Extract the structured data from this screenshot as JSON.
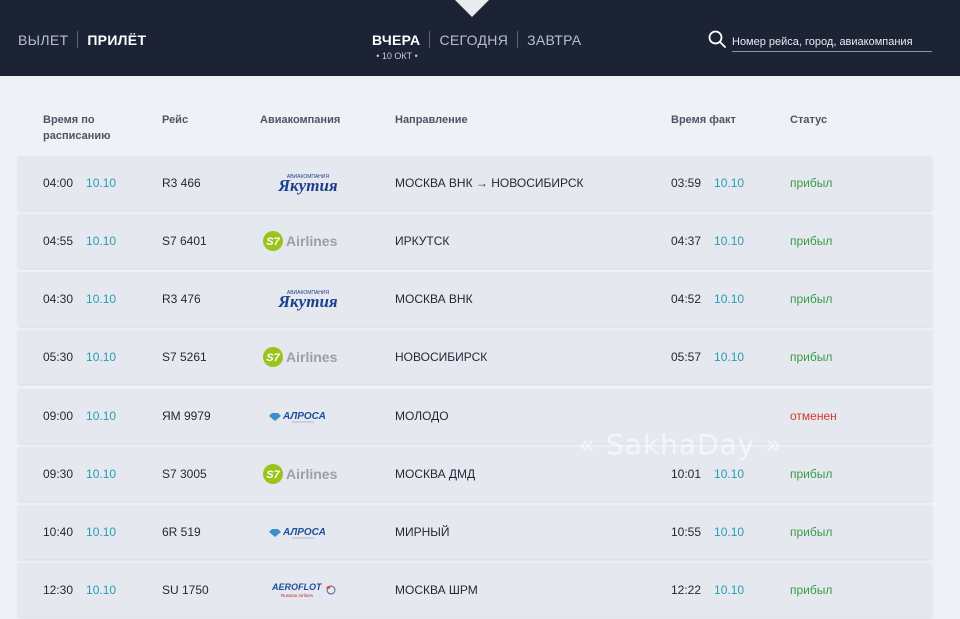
{
  "header": {
    "direction_tabs": [
      {
        "label": "ВЫЛЕТ",
        "active": false
      },
      {
        "label": "ПРИЛЁТ",
        "active": true
      }
    ],
    "day_tabs": [
      {
        "label": "ВЧЕРА",
        "active": true
      },
      {
        "label": "СЕГОДНЯ",
        "active": false
      },
      {
        "label": "ЗАВТРА",
        "active": false
      }
    ],
    "selected_date": "• 10 ОКТ •",
    "search": {
      "placeholder": "Номер рейса, город, авиакомпания",
      "value": ""
    }
  },
  "table": {
    "columns": {
      "scheduled": "Время по расписанию",
      "flight": "Рейс",
      "airline": "Авиакомпания",
      "route": "Направление",
      "actual": "Время факт",
      "status": "Статус"
    },
    "rows": [
      {
        "sched_time": "04:00",
        "sched_date": "10.10",
        "flight": "R3 466",
        "airline_logo": "yakutia-logo",
        "airline_text": "Якутия",
        "airline_sub": "АВИАКОМПАНИЯ",
        "route": "МОСКВА ВНК → НОВОСИБИРСК",
        "actual_time": "03:59",
        "actual_date": "10.10",
        "status": "прибыл",
        "status_kind": "arrived"
      },
      {
        "sched_time": "04:55",
        "sched_date": "10.10",
        "flight": "S7 6401",
        "airline_logo": "s7-logo",
        "airline_text": "Airlines",
        "airline_sub": "S7",
        "route": "ИРКУТСК",
        "actual_time": "04:37",
        "actual_date": "10.10",
        "status": "прибыл",
        "status_kind": "arrived"
      },
      {
        "sched_time": "04:30",
        "sched_date": "10.10",
        "flight": "R3 476",
        "airline_logo": "yakutia-logo",
        "airline_text": "Якутия",
        "airline_sub": "АВИАКОМПАНИЯ",
        "route": "МОСКВА ВНК",
        "actual_time": "04:52",
        "actual_date": "10.10",
        "status": "прибыл",
        "status_kind": "arrived"
      },
      {
        "sched_time": "05:30",
        "sched_date": "10.10",
        "flight": "S7 5261",
        "airline_logo": "s7-logo",
        "airline_text": "Airlines",
        "airline_sub": "S7",
        "route": "НОВОСИБИРСК",
        "actual_time": "05:57",
        "actual_date": "10.10",
        "status": "прибыл",
        "status_kind": "arrived"
      },
      {
        "sched_time": "09:00",
        "sched_date": "10.10",
        "flight": "ЯМ 9979",
        "airline_logo": "alrosa-logo",
        "airline_text": "АЛРОСА",
        "airline_sub": "",
        "route": "МОЛОДО",
        "actual_time": "",
        "actual_date": "",
        "status": "отменен",
        "status_kind": "cancelled"
      },
      {
        "sched_time": "09:30",
        "sched_date": "10.10",
        "flight": "S7 3005",
        "airline_logo": "s7-logo",
        "airline_text": "Airlines",
        "airline_sub": "S7",
        "route": "МОСКВА ДМД",
        "actual_time": "10:01",
        "actual_date": "10.10",
        "status": "прибыл",
        "status_kind": "arrived"
      },
      {
        "sched_time": "10:40",
        "sched_date": "10.10",
        "flight": "6R 519",
        "airline_logo": "alrosa-logo",
        "airline_text": "АЛРОСА",
        "airline_sub": "",
        "route": "МИРНЫЙ",
        "actual_time": "10:55",
        "actual_date": "10.10",
        "status": "прибыл",
        "status_kind": "arrived"
      },
      {
        "sched_time": "12:30",
        "sched_date": "10.10",
        "flight": "SU 1750",
        "airline_logo": "aeroflot-logo",
        "airline_text": "AEROFLOT",
        "airline_sub": "Russian Airlines",
        "route": "МОСКВА ШРМ",
        "actual_time": "12:22",
        "actual_date": "10.10",
        "status": "прибыл",
        "status_kind": "arrived"
      }
    ]
  },
  "watermark": "« SakhaDay »",
  "colors": {
    "header_bg": "#1c2335",
    "page_bg": "#eef1f5",
    "row_bg": "#e5e9ef",
    "date_accent": "#2a9bb5",
    "status_arrived": "#3a9a4a",
    "status_cancelled": "#cf3a2c",
    "s7_green": "#9ac31c",
    "yakutia_blue": "#1c3f8f",
    "alrosa_blue": "#1d4e9a",
    "aeroflot_blue": "#1e4a9b"
  }
}
